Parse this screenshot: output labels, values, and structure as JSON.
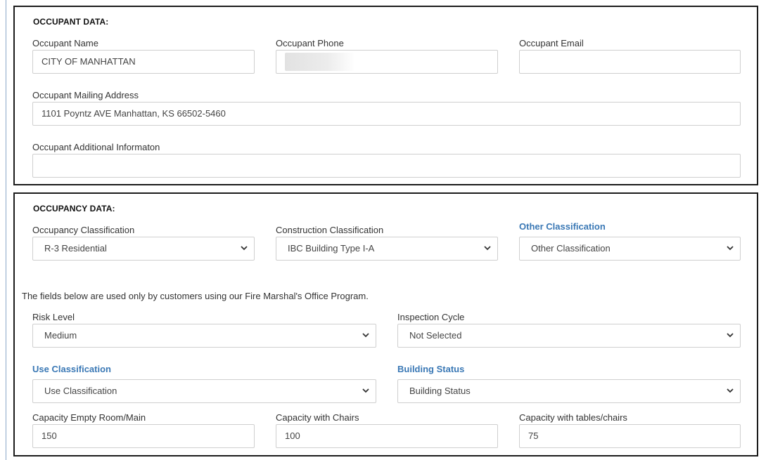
{
  "occupant": {
    "title": "OCCUPANT DATA:",
    "name_label": "Occupant Name",
    "name_value": "CITY OF MANHATTAN",
    "phone_label": "Occupant Phone",
    "phone_value": "",
    "email_label": "Occupant Email",
    "email_value": "",
    "mailing_label": "Occupant Mailing Address",
    "mailing_value": "1101 Poyntz AVE Manhattan, KS 66502-5460",
    "additional_label": "Occupant Additional Informaton",
    "additional_value": ""
  },
  "occupancy": {
    "title": "OCCUPANCY DATA:",
    "occupancy_class_label": "Occupancy Classification",
    "occupancy_class_value": "R-3 Residential",
    "construction_class_label": "Construction Classification",
    "construction_class_value": "IBC Building Type I-A",
    "other_class_label": "Other Classification",
    "other_class_value": "Other Classification",
    "fmo_note": "The fields below are used only by customers using our Fire Marshal's Office Program.",
    "risk_label": "Risk Level",
    "risk_value": "Medium",
    "inspection_label": "Inspection Cycle",
    "inspection_value": "Not Selected",
    "use_class_label": "Use Classification",
    "use_class_value": "Use Classification",
    "building_status_label": "Building Status",
    "building_status_value": "Building Status",
    "cap_empty_label": "Capacity Empty Room/Main",
    "cap_empty_value": "150",
    "cap_chairs_label": "Capacity with Chairs",
    "cap_chairs_value": "100",
    "cap_tables_label": "Capacity with tables/chairs",
    "cap_tables_value": "75"
  },
  "colors": {
    "accent_label": "#3a78b5",
    "section_border": "#1b1b1b",
    "field_border": "#cfcfcf"
  },
  "icons": {
    "select_arrow": "chevron-down-icon"
  }
}
